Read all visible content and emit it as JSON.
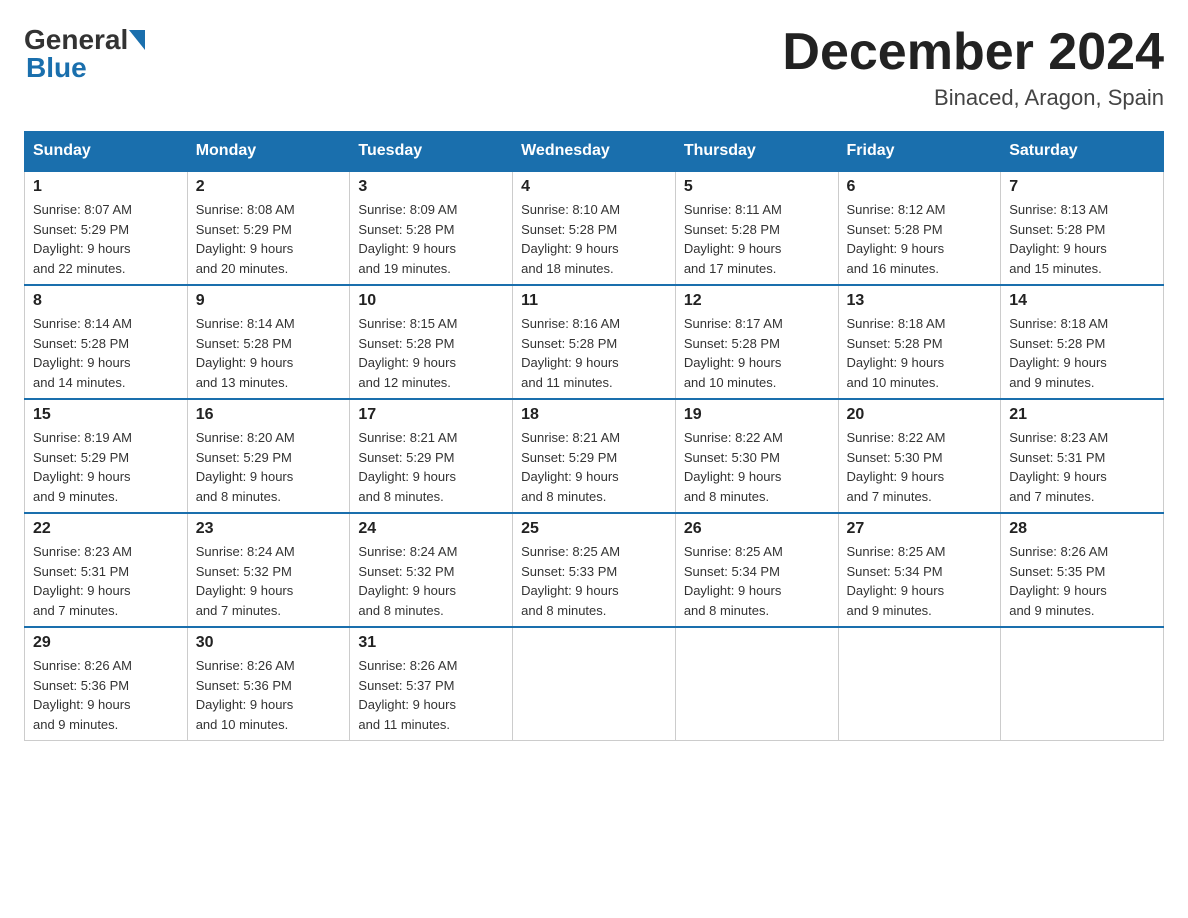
{
  "header": {
    "month_title": "December 2024",
    "location": "Binaced, Aragon, Spain",
    "logo_general": "General",
    "logo_blue": "Blue"
  },
  "days_of_week": [
    "Sunday",
    "Monday",
    "Tuesday",
    "Wednesday",
    "Thursday",
    "Friday",
    "Saturday"
  ],
  "weeks": [
    [
      {
        "day": "1",
        "sunrise": "8:07 AM",
        "sunset": "5:29 PM",
        "daylight": "9 hours and 22 minutes."
      },
      {
        "day": "2",
        "sunrise": "8:08 AM",
        "sunset": "5:29 PM",
        "daylight": "9 hours and 20 minutes."
      },
      {
        "day": "3",
        "sunrise": "8:09 AM",
        "sunset": "5:28 PM",
        "daylight": "9 hours and 19 minutes."
      },
      {
        "day": "4",
        "sunrise": "8:10 AM",
        "sunset": "5:28 PM",
        "daylight": "9 hours and 18 minutes."
      },
      {
        "day": "5",
        "sunrise": "8:11 AM",
        "sunset": "5:28 PM",
        "daylight": "9 hours and 17 minutes."
      },
      {
        "day": "6",
        "sunrise": "8:12 AM",
        "sunset": "5:28 PM",
        "daylight": "9 hours and 16 minutes."
      },
      {
        "day": "7",
        "sunrise": "8:13 AM",
        "sunset": "5:28 PM",
        "daylight": "9 hours and 15 minutes."
      }
    ],
    [
      {
        "day": "8",
        "sunrise": "8:14 AM",
        "sunset": "5:28 PM",
        "daylight": "9 hours and 14 minutes."
      },
      {
        "day": "9",
        "sunrise": "8:14 AM",
        "sunset": "5:28 PM",
        "daylight": "9 hours and 13 minutes."
      },
      {
        "day": "10",
        "sunrise": "8:15 AM",
        "sunset": "5:28 PM",
        "daylight": "9 hours and 12 minutes."
      },
      {
        "day": "11",
        "sunrise": "8:16 AM",
        "sunset": "5:28 PM",
        "daylight": "9 hours and 11 minutes."
      },
      {
        "day": "12",
        "sunrise": "8:17 AM",
        "sunset": "5:28 PM",
        "daylight": "9 hours and 10 minutes."
      },
      {
        "day": "13",
        "sunrise": "8:18 AM",
        "sunset": "5:28 PM",
        "daylight": "9 hours and 10 minutes."
      },
      {
        "day": "14",
        "sunrise": "8:18 AM",
        "sunset": "5:28 PM",
        "daylight": "9 hours and 9 minutes."
      }
    ],
    [
      {
        "day": "15",
        "sunrise": "8:19 AM",
        "sunset": "5:29 PM",
        "daylight": "9 hours and 9 minutes."
      },
      {
        "day": "16",
        "sunrise": "8:20 AM",
        "sunset": "5:29 PM",
        "daylight": "9 hours and 8 minutes."
      },
      {
        "day": "17",
        "sunrise": "8:21 AM",
        "sunset": "5:29 PM",
        "daylight": "9 hours and 8 minutes."
      },
      {
        "day": "18",
        "sunrise": "8:21 AM",
        "sunset": "5:29 PM",
        "daylight": "9 hours and 8 minutes."
      },
      {
        "day": "19",
        "sunrise": "8:22 AM",
        "sunset": "5:30 PM",
        "daylight": "9 hours and 8 minutes."
      },
      {
        "day": "20",
        "sunrise": "8:22 AM",
        "sunset": "5:30 PM",
        "daylight": "9 hours and 7 minutes."
      },
      {
        "day": "21",
        "sunrise": "8:23 AM",
        "sunset": "5:31 PM",
        "daylight": "9 hours and 7 minutes."
      }
    ],
    [
      {
        "day": "22",
        "sunrise": "8:23 AM",
        "sunset": "5:31 PM",
        "daylight": "9 hours and 7 minutes."
      },
      {
        "day": "23",
        "sunrise": "8:24 AM",
        "sunset": "5:32 PM",
        "daylight": "9 hours and 7 minutes."
      },
      {
        "day": "24",
        "sunrise": "8:24 AM",
        "sunset": "5:32 PM",
        "daylight": "9 hours and 8 minutes."
      },
      {
        "day": "25",
        "sunrise": "8:25 AM",
        "sunset": "5:33 PM",
        "daylight": "9 hours and 8 minutes."
      },
      {
        "day": "26",
        "sunrise": "8:25 AM",
        "sunset": "5:34 PM",
        "daylight": "9 hours and 8 minutes."
      },
      {
        "day": "27",
        "sunrise": "8:25 AM",
        "sunset": "5:34 PM",
        "daylight": "9 hours and 9 minutes."
      },
      {
        "day": "28",
        "sunrise": "8:26 AM",
        "sunset": "5:35 PM",
        "daylight": "9 hours and 9 minutes."
      }
    ],
    [
      {
        "day": "29",
        "sunrise": "8:26 AM",
        "sunset": "5:36 PM",
        "daylight": "9 hours and 9 minutes."
      },
      {
        "day": "30",
        "sunrise": "8:26 AM",
        "sunset": "5:36 PM",
        "daylight": "9 hours and 10 minutes."
      },
      {
        "day": "31",
        "sunrise": "8:26 AM",
        "sunset": "5:37 PM",
        "daylight": "9 hours and 11 minutes."
      },
      null,
      null,
      null,
      null
    ]
  ],
  "labels": {
    "sunrise": "Sunrise:",
    "sunset": "Sunset:",
    "daylight": "Daylight:"
  }
}
